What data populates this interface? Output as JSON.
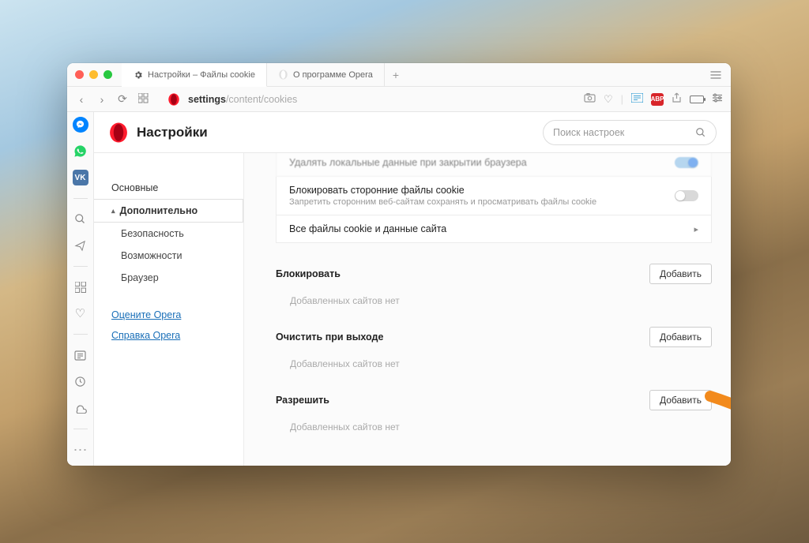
{
  "tabs": {
    "active": {
      "label": "Настройки – Файлы cookie"
    },
    "second": {
      "label": "О программе Opera"
    }
  },
  "address": {
    "prefix": "settings",
    "path": "/content/cookies"
  },
  "adblock_abbr": "ABP",
  "header": {
    "title": "Настройки",
    "search_placeholder": "Поиск настроек"
  },
  "nav": {
    "basic": "Основные",
    "advanced": "Дополнительно",
    "security": "Безопасность",
    "features": "Возможности",
    "browser": "Браузер",
    "rate": "Оцените Opera",
    "help": "Справка Opera"
  },
  "settings": {
    "row_delete": "Удалять локальные данные при закрытии браузера",
    "row_block_title": "Блокировать сторонние файлы cookie",
    "row_block_sub": "Запретить сторонним веб-сайтам сохранять и просматривать файлы cookie",
    "row_all": "Все файлы cookie и данные сайта"
  },
  "sections": {
    "block": "Блокировать",
    "clear": "Очистить при выходе",
    "allow": "Разрешить",
    "add_button": "Добавить",
    "empty": "Добавленных сайтов нет"
  },
  "vk_label": "VK"
}
